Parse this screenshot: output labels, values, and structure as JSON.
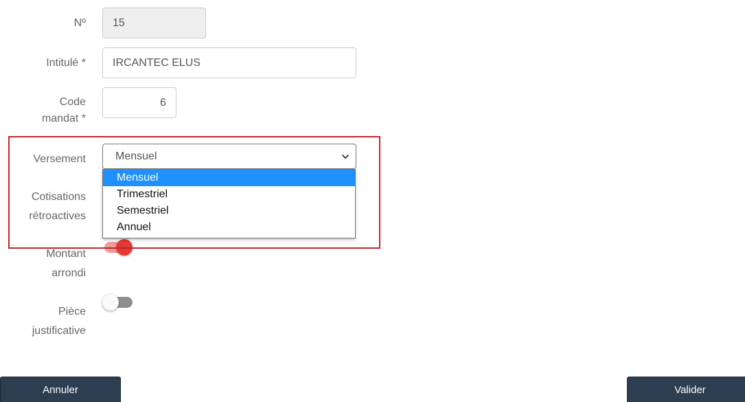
{
  "form": {
    "numero": {
      "label": "Nº",
      "value": "15"
    },
    "intitule": {
      "label": "Intitulé *",
      "value": "IRCANTEC ELUS"
    },
    "code_mandat": {
      "label_line1": "Code",
      "label_line2": "mandat *",
      "value": "6"
    },
    "versement": {
      "label": "Versement",
      "selected": "Mensuel",
      "icon": "chevron-down-icon",
      "options": [
        "Mensuel",
        "Trimestriel",
        "Semestriel",
        "Annuel"
      ]
    },
    "cotisations": {
      "label_line1": "Cotisations",
      "label_line2": "rétroactives"
    },
    "montant": {
      "label_line1": "Montant",
      "label_line2": "arrondi",
      "checked": true
    },
    "piece": {
      "label_line1": "Pièce",
      "label_line2": "justificative",
      "checked": false
    }
  },
  "buttons": {
    "cancel": "Annuler",
    "validate": "Valider"
  },
  "colors": {
    "highlight_border": "#c0262c",
    "toggle_on_track": "#f19a9a",
    "toggle_on_knob": "#e53935",
    "toggle_off_track": "#8e8e8e",
    "option_selected": "#1e90ff",
    "button_bg": "#2c3e50"
  }
}
